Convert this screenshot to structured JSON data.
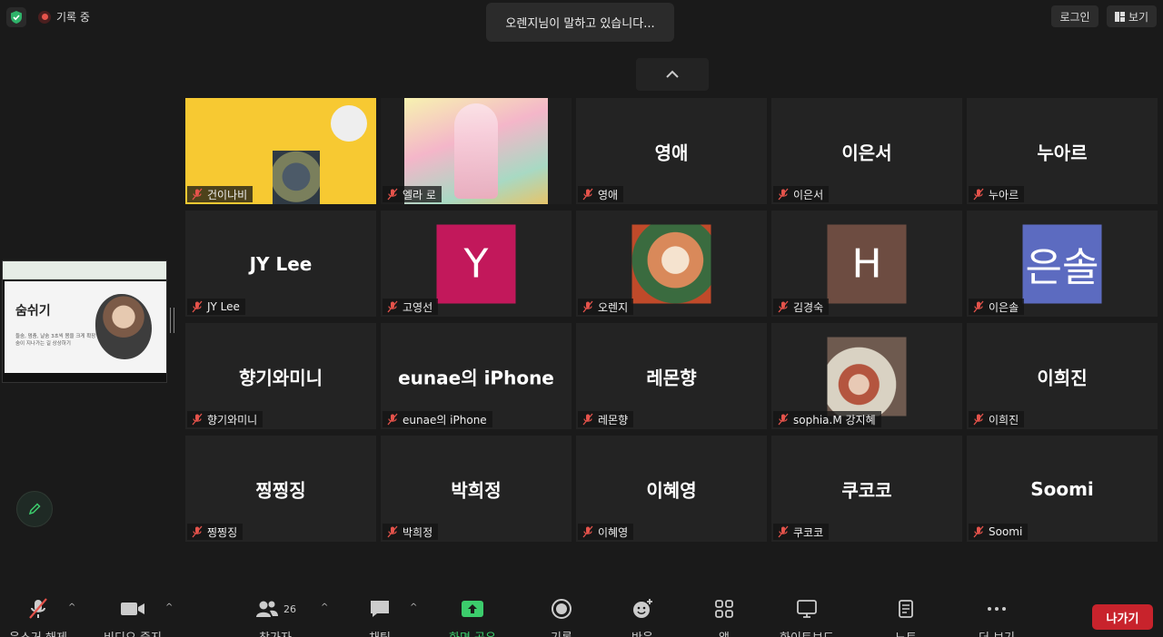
{
  "topbar": {
    "recording_label": "기록 중",
    "speaker_text": "오렌지님이 말하고 있습니다...",
    "login_label": "로그인",
    "view_label": "보기"
  },
  "shared_screen": {
    "slide_title": "숨쉬기",
    "slide_text": "들숨, 멈춤, 날숨 3초씩 몸을 크게 확장 숨이 지나가는 길 상상하기"
  },
  "participants": [
    {
      "name": "건이나비",
      "display": "",
      "kind": "video-yellow"
    },
    {
      "name": "엘라 로",
      "display": "",
      "kind": "video-art"
    },
    {
      "name": "영애",
      "display": "영애",
      "kind": "name"
    },
    {
      "name": "이은서",
      "display": "이은서",
      "kind": "name"
    },
    {
      "name": "누아르",
      "display": "누아르",
      "kind": "name"
    },
    {
      "name": "JY Lee",
      "display": "JY Lee",
      "kind": "name"
    },
    {
      "name": "고영선",
      "display": "Y",
      "kind": "letter",
      "color": "#c2185b"
    },
    {
      "name": "오렌지",
      "display": "",
      "kind": "pic-orange"
    },
    {
      "name": "김경숙",
      "display": "H",
      "kind": "letter",
      "color": "#6d4c41"
    },
    {
      "name": "이은솔",
      "display": "은솔",
      "kind": "letter",
      "color": "#5c6bc0"
    },
    {
      "name": "향기와미니",
      "display": "향기와미니",
      "kind": "name"
    },
    {
      "name": "eunae의 iPhone",
      "display": "eunae의 iPhone",
      "kind": "name"
    },
    {
      "name": "레몬향",
      "display": "레몬향",
      "kind": "name"
    },
    {
      "name": "sophia.M 강지혜",
      "display": "",
      "kind": "pic-sophia"
    },
    {
      "name": "이희진",
      "display": "이희진",
      "kind": "name"
    },
    {
      "name": "찡찡징",
      "display": "찡찡징",
      "kind": "name"
    },
    {
      "name": "박희정",
      "display": "박희정",
      "kind": "name"
    },
    {
      "name": "이혜영",
      "display": "이혜영",
      "kind": "name"
    },
    {
      "name": "쿠코코",
      "display": "쿠코코",
      "kind": "name"
    },
    {
      "name": "Soomi",
      "display": "Soomi",
      "kind": "name"
    }
  ],
  "toolbar": {
    "unmute": "음소거 해제",
    "stop_video": "비디오 중지",
    "participants": "참가자",
    "participant_count": "26",
    "chat": "채팅",
    "share_screen": "화면 공유",
    "record": "기록",
    "reactions": "반응",
    "apps": "앱",
    "whiteboard": "화이트보드",
    "notes": "노트",
    "more": "더 보기",
    "leave": "나가기"
  },
  "colors": {
    "share_green": "#3ccc6c",
    "leave_red": "#c8232c",
    "mute_red": "#e5534b"
  }
}
